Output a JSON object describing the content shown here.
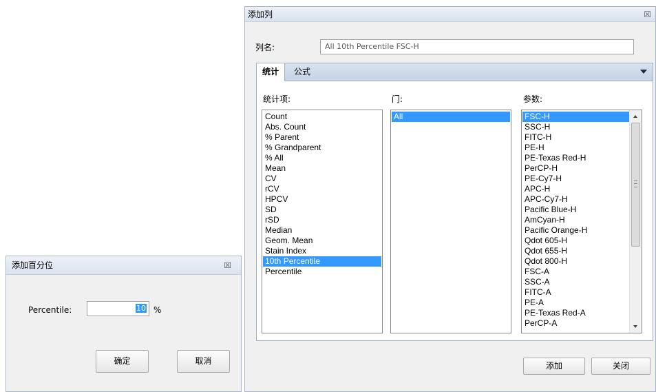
{
  "add_column_dialog": {
    "title": "添加列",
    "close_glyph": "☒",
    "column_name_label": "列名:",
    "column_name_value": "All 10th Percentile FSC-H",
    "tabs": [
      {
        "label": "统计"
      },
      {
        "label": "公式"
      }
    ],
    "statistics_label": "统计项:",
    "gate_label": "门:",
    "params_label": "参数:",
    "statistics": [
      "Count",
      "Abs. Count",
      "% Parent",
      "% Grandparent",
      "% All",
      "Mean",
      "CV",
      "rCV",
      "HPCV",
      "SD",
      "rSD",
      "Median",
      "Geom. Mean",
      "Stain Index",
      "10th Percentile",
      "Percentile"
    ],
    "statistics_selected": "10th Percentile",
    "gates": [
      "All"
    ],
    "gates_selected": "All",
    "params": [
      "FSC-H",
      "SSC-H",
      "FITC-H",
      "PE-H",
      "PE-Texas Red-H",
      "PerCP-H",
      "PE-Cy7-H",
      "APC-H",
      "APC-Cy7-H",
      "Pacific Blue-H",
      "AmCyan-H",
      "Pacific Orange-H",
      "Qdot 605-H",
      "Qdot 655-H",
      "Qdot 800-H",
      "FSC-A",
      "SSC-A",
      "FITC-A",
      "PE-A",
      "PE-Texas Red-A",
      "PerCP-A"
    ],
    "params_selected": "FSC-H",
    "add_button": "添加",
    "close_button": "关闭"
  },
  "add_percentile_dialog": {
    "title": "添加百分位",
    "close_glyph": "☒",
    "percentile_label": "Percentile:",
    "percentile_value": "10",
    "percent_sign": "%",
    "ok_button": "确定",
    "cancel_button": "取消"
  },
  "colors": {
    "selection": "#3399ff",
    "dialog_bg": "#f0f0f0",
    "titlebar": "#d9e2ee"
  }
}
